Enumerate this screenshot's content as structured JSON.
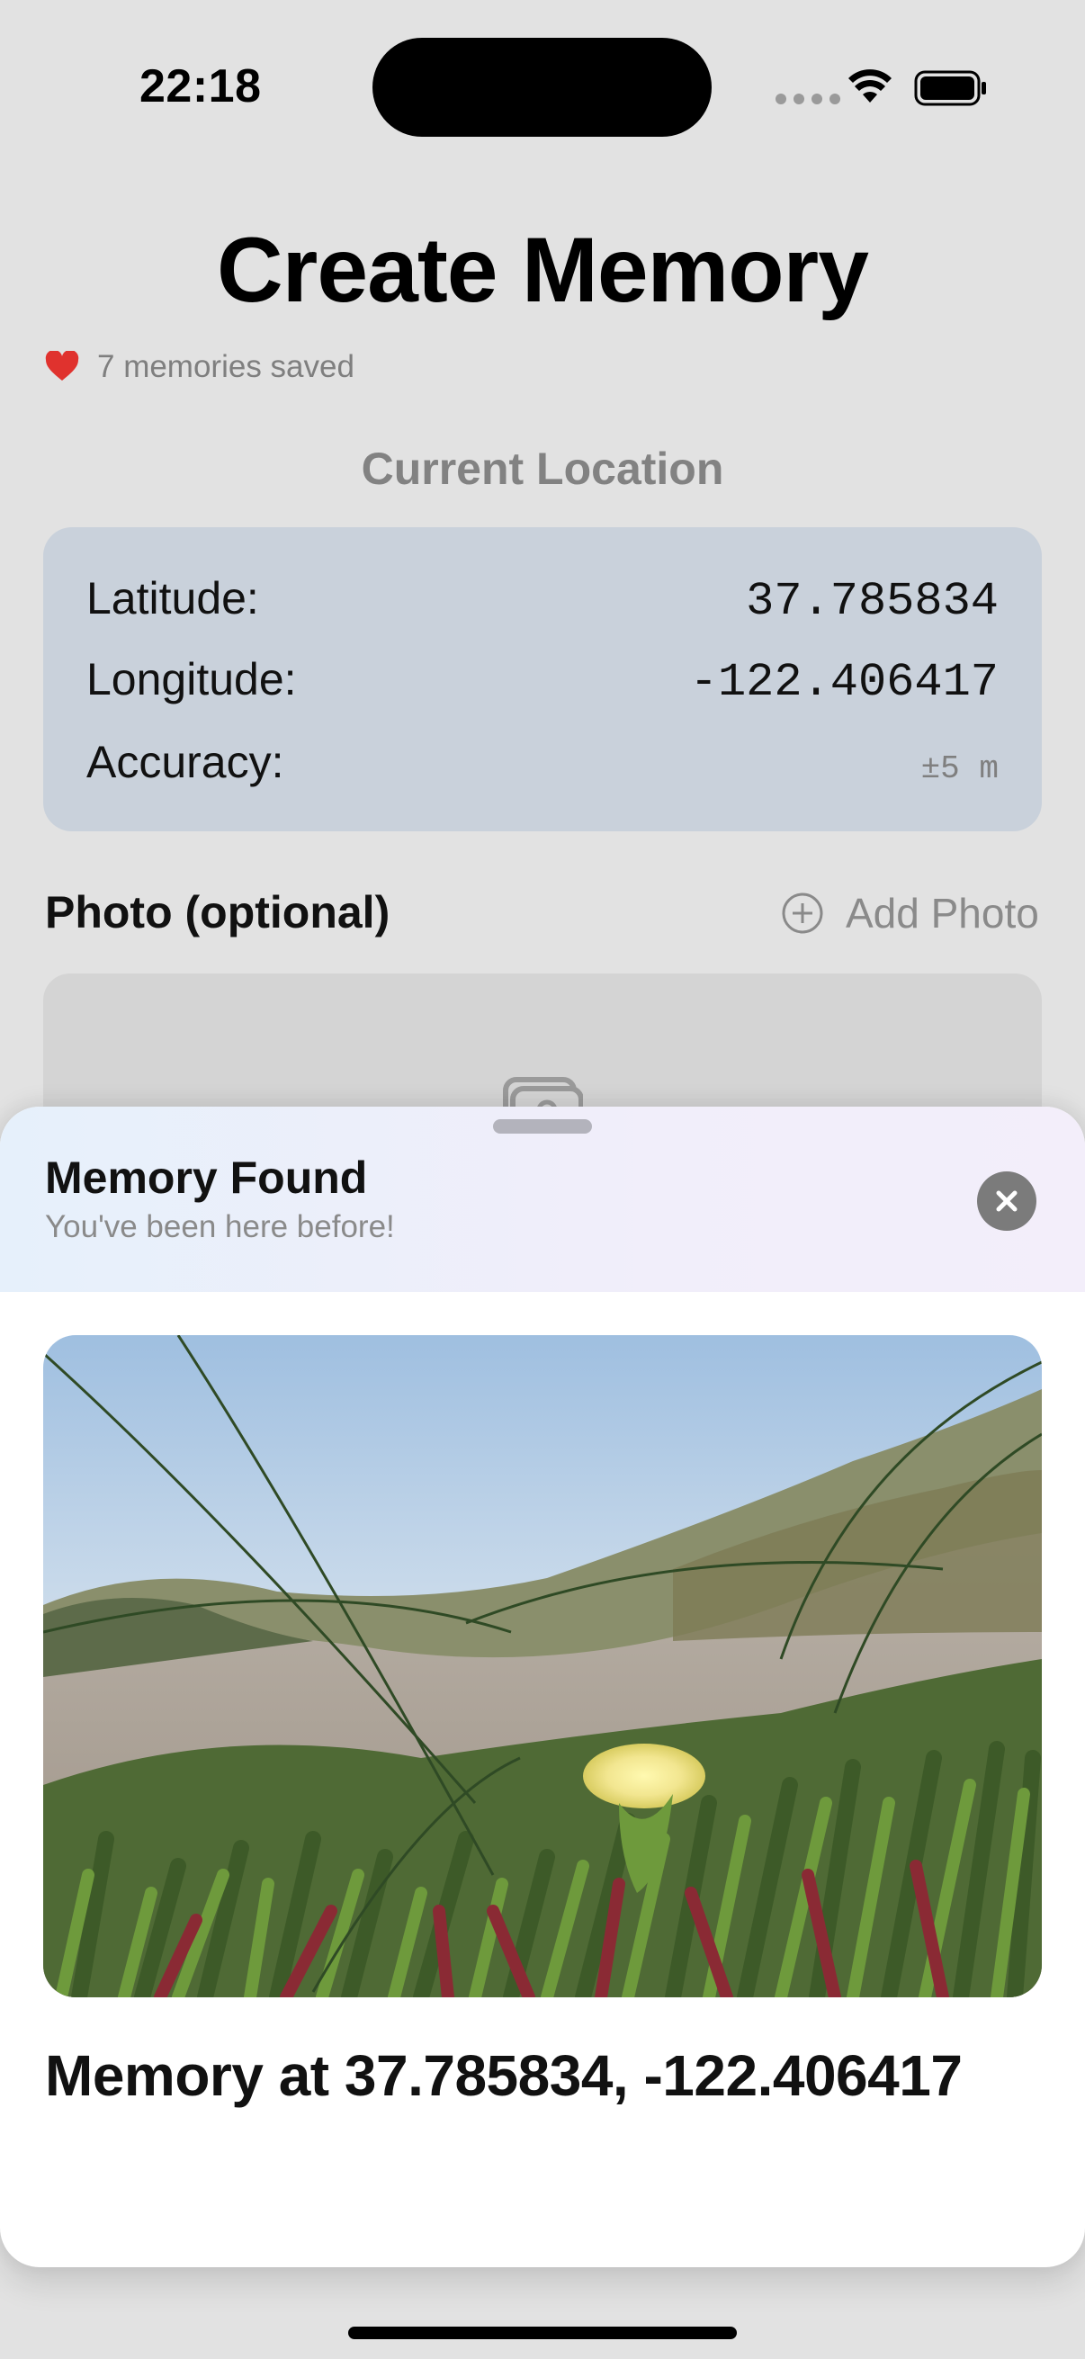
{
  "status_bar": {
    "time": "22:18"
  },
  "header": {
    "title": "Create Memory",
    "memories_count": "7 memories saved"
  },
  "location": {
    "title": "Current Location",
    "rows": [
      {
        "label": "Latitude:",
        "value": "37.785834"
      },
      {
        "label": "Longitude:",
        "value": "-122.406417"
      },
      {
        "label": "Accuracy:",
        "value": "±5 m"
      }
    ]
  },
  "photo": {
    "label": "Photo (optional)",
    "add_label": "Add Photo"
  },
  "sheet": {
    "title": "Memory Found",
    "subtitle": "You've been here before!",
    "caption": "Memory at 37.785834, -122.406417"
  },
  "colors": {
    "accent_heart": "#e0322e",
    "card_bg": "#c9d1db"
  },
  "icons": [
    "heart-icon",
    "plus-circle-icon",
    "photo-placeholder-icon",
    "close-icon",
    "wifi-icon",
    "battery-icon"
  ]
}
